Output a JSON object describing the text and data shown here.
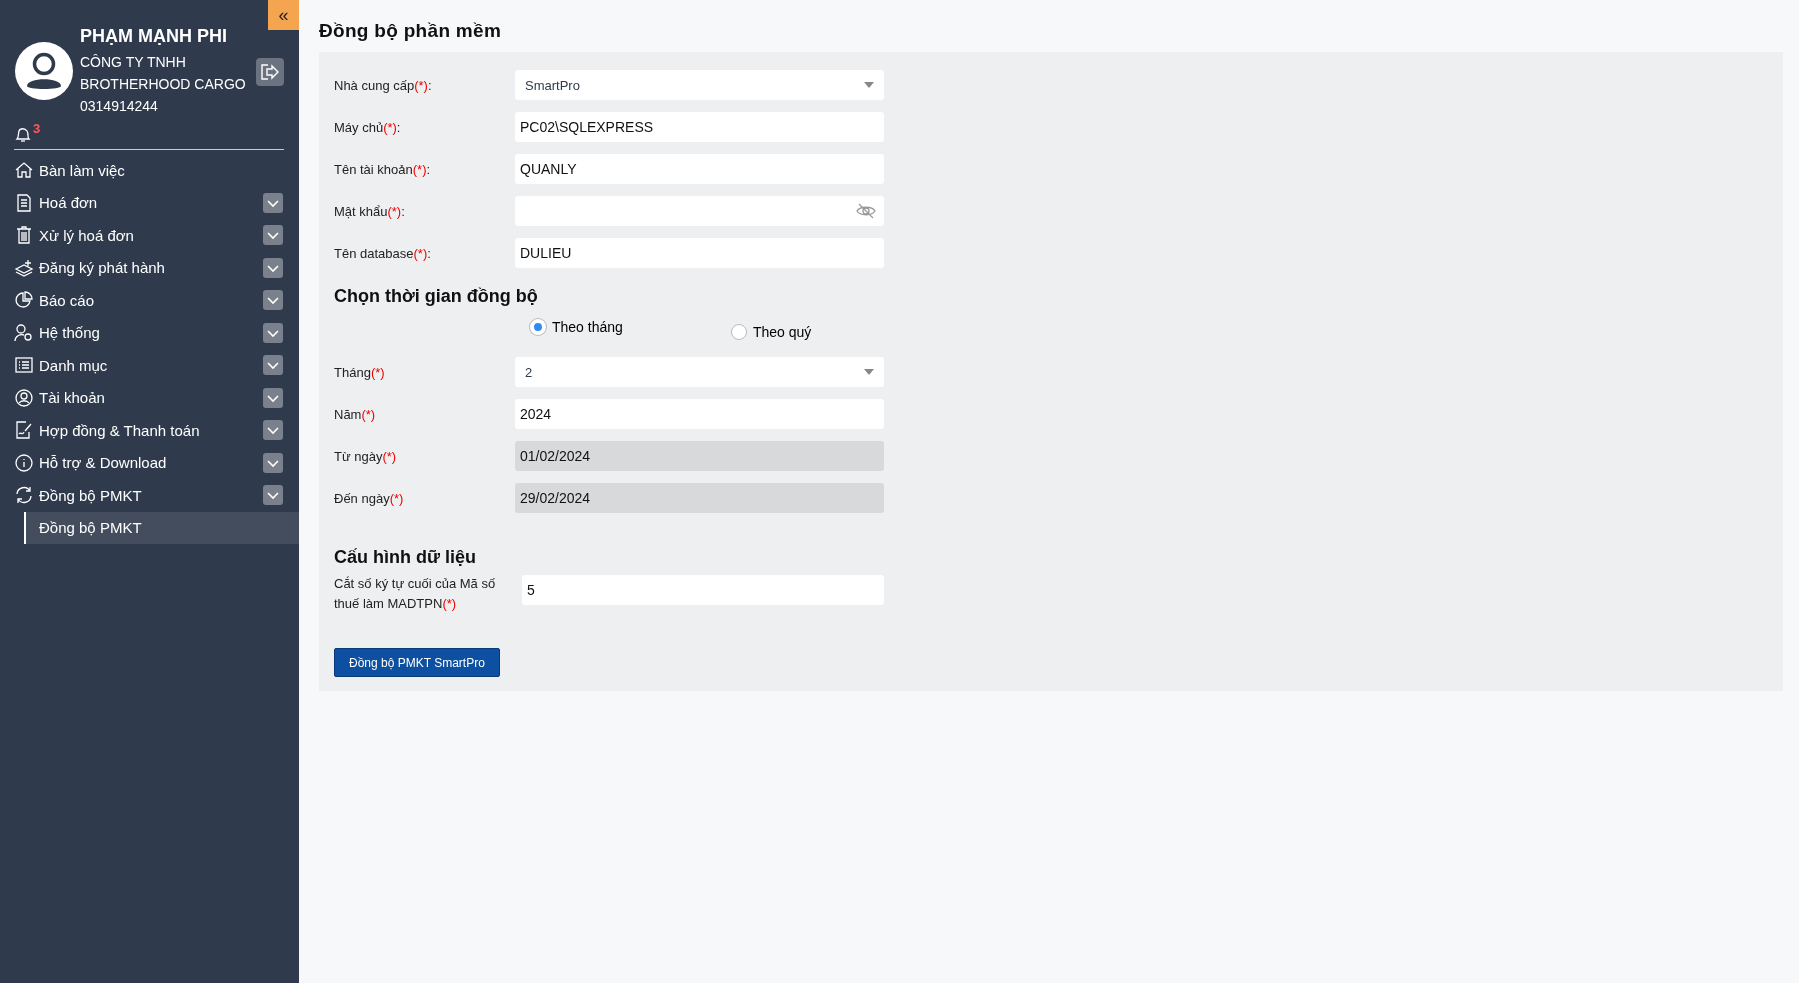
{
  "sidebar": {
    "collapse_button": "«",
    "user": {
      "name": "PHẠM MẠNH PHI",
      "company_lines": [
        "CÔNG TY TNHH",
        "BROTHERHOOD CARGO"
      ],
      "tax_code": "0314914244"
    },
    "notifications": {
      "count": "3"
    },
    "menu": [
      {
        "label": "Bàn làm việc",
        "expandable": false
      },
      {
        "label": "Hoá đơn",
        "expandable": true
      },
      {
        "label": "Xử lý hoá đơn",
        "expandable": true
      },
      {
        "label": "Đăng ký phát hành",
        "expandable": true
      },
      {
        "label": "Báo cáo",
        "expandable": true
      },
      {
        "label": "Hệ thống",
        "expandable": true
      },
      {
        "label": "Danh mục",
        "expandable": true
      },
      {
        "label": "Tài khoản",
        "expandable": true
      },
      {
        "label": "Hợp đồng & Thanh toán",
        "expandable": true
      },
      {
        "label": "Hỗ trợ & Download",
        "expandable": true
      },
      {
        "label": "Đồng bộ PMKT",
        "expandable": true,
        "children": [
          {
            "label": "Đồng bộ PMKT",
            "selected": true
          }
        ]
      }
    ]
  },
  "page": {
    "title": "Đồng bộ phần mềm",
    "connection_fields": [
      {
        "kind": "select",
        "label": "Nhà cung cấp",
        "required": "(*)",
        "colon": ":",
        "value": "SmartPro"
      },
      {
        "kind": "text",
        "label": "Máy chủ",
        "required": "(*)",
        "colon": ":",
        "value": "PC02\\SQLEXPRESS"
      },
      {
        "kind": "text",
        "label": "Tên tài khoản",
        "required": "(*)",
        "colon": ":",
        "value": "QUANLY"
      },
      {
        "kind": "password",
        "label": "Mật khẩu",
        "required": "(*)",
        "colon": ":"
      },
      {
        "kind": "text",
        "label": "Tên database",
        "required": "(*)",
        "colon": ":",
        "value": "DULIEU"
      }
    ],
    "time_section": {
      "heading": "Chọn thời gian đồng bộ",
      "radios": [
        {
          "label": "Theo tháng",
          "selected": true
        },
        {
          "label": "Theo quý",
          "selected": false
        }
      ],
      "fields": [
        {
          "kind": "select",
          "label": "Tháng",
          "required": "(*)",
          "value": "2"
        },
        {
          "kind": "text",
          "label": "Năm",
          "required": "(*)",
          "value": "2024"
        },
        {
          "kind": "readonly",
          "label": "Từ ngày",
          "required": "(*)",
          "value": "01/02/2024"
        },
        {
          "kind": "readonly",
          "label": "Đến ngày",
          "required": "(*)",
          "value": "29/02/2024"
        }
      ]
    },
    "config_section": {
      "heading": "Cấu hình dữ liệu",
      "fields": [
        {
          "kind": "text",
          "label": "Cắt số ký tự cuối của Mã số thuế làm MADTPN",
          "required": "(*)",
          "value": "5"
        }
      ]
    },
    "submit_button": "Đồng bộ PMKT SmartPro"
  }
}
